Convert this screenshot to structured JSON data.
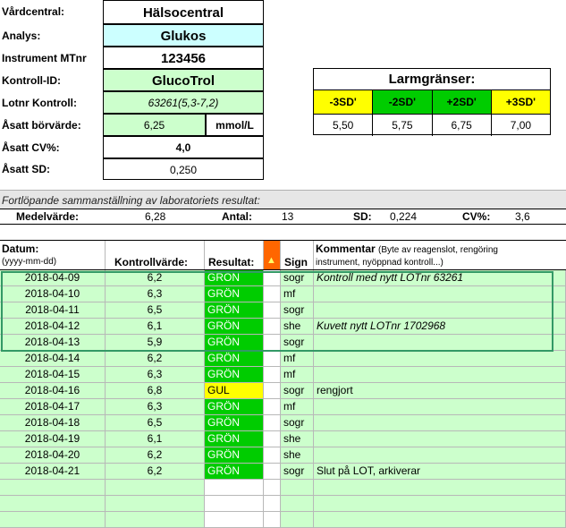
{
  "header": {
    "vardcentral_label": "Vårdcentral:",
    "vardcentral_value": "Hälsocentral",
    "analys_label": "Analys:",
    "analys_value": "Glukos",
    "instrument_label": "Instrument MTnr",
    "instrument_value": "123456",
    "kontroll_label": "Kontroll-ID:",
    "kontroll_value": "GlucoTrol",
    "lotnr_label": "Lotnr Kontroll:",
    "lotnr_value": "63261(5,3-7,2)",
    "borvarde_label": "Åsatt börvärde:",
    "borvarde_value": "6,25",
    "borvarde_unit": "mmol/L",
    "cv_label": "Åsatt CV%:",
    "cv_value": "4,0",
    "sd_label": "Åsatt SD:",
    "sd_value": "0,250"
  },
  "larm": {
    "title": "Larmgränser:",
    "headers": [
      "-3SD'",
      "-2SD'",
      "+2SD'",
      "+3SD'"
    ],
    "values": [
      "5,50",
      "5,75",
      "6,75",
      "7,00"
    ],
    "colors": [
      "#ffff00",
      "#00cc00",
      "#00cc00",
      "#ffff00"
    ]
  },
  "summary": {
    "caption": "Fortlöpande sammanställning av laboratoriets resultat:",
    "medel_label": "Medelvärde:",
    "medel_value": "6,28",
    "antal_label": "Antal:",
    "antal_value": "13",
    "sd_label": "SD:",
    "sd_value": "0,224",
    "cv_label": "CV%:",
    "cv_value": "3,6"
  },
  "table": {
    "col_datum": "Datum:",
    "col_datum_sub": "(yyyy-mm-dd)",
    "col_kontroll": "Kontrollvärde:",
    "col_resultat": "Resultat:",
    "col_sign": "Sign",
    "col_kommentar": "Kommentar",
    "col_kommentar_sub": "(Byte av reagenslot, rengöring",
    "col_kommentar_sub2": "instrument, nyöppnad kontroll...)",
    "rows": [
      {
        "date": "2018-04-09",
        "value": "6,2",
        "result": "GRÖN",
        "sign": "sogr",
        "comment": "Kontroll med nytt LOTnr 63261",
        "italic": true
      },
      {
        "date": "2018-04-10",
        "value": "6,3",
        "result": "GRÖN",
        "sign": "mf",
        "comment": "",
        "italic": false
      },
      {
        "date": "2018-04-11",
        "value": "6,5",
        "result": "GRÖN",
        "sign": "sogr",
        "comment": "",
        "italic": false
      },
      {
        "date": "2018-04-12",
        "value": "6,1",
        "result": "GRÖN",
        "sign": "she",
        "comment": "Kuvett nytt LOTnr 1702968",
        "italic": true
      },
      {
        "date": "2018-04-13",
        "value": "5,9",
        "result": "GRÖN",
        "sign": "sogr",
        "comment": "",
        "italic": false
      },
      {
        "date": "2018-04-14",
        "value": "6,2",
        "result": "GRÖN",
        "sign": "mf",
        "comment": "",
        "italic": false
      },
      {
        "date": "2018-04-15",
        "value": "6,3",
        "result": "GRÖN",
        "sign": "mf",
        "comment": "",
        "italic": false
      },
      {
        "date": "2018-04-16",
        "value": "6,8",
        "result": "GUL",
        "sign": "sogr",
        "comment": "rengjort",
        "italic": false
      },
      {
        "date": "2018-04-17",
        "value": "6,3",
        "result": "GRÖN",
        "sign": "mf",
        "comment": "",
        "italic": false
      },
      {
        "date": "2018-04-18",
        "value": "6,5",
        "result": "GRÖN",
        "sign": "sogr",
        "comment": "",
        "italic": false
      },
      {
        "date": "2018-04-19",
        "value": "6,1",
        "result": "GRÖN",
        "sign": "she",
        "comment": "",
        "italic": false
      },
      {
        "date": "2018-04-20",
        "value": "6,2",
        "result": "GRÖN",
        "sign": "she",
        "comment": "",
        "italic": false
      },
      {
        "date": "2018-04-21",
        "value": "6,2",
        "result": "GRÖN",
        "sign": "sogr",
        "comment": "Slut på LOT, arkiverar",
        "italic": false
      },
      {
        "date": "",
        "value": "",
        "result": "",
        "sign": "",
        "comment": "",
        "italic": false
      },
      {
        "date": "",
        "value": "",
        "result": "",
        "sign": "",
        "comment": "",
        "italic": false
      },
      {
        "date": "",
        "value": "",
        "result": "",
        "sign": "",
        "comment": "",
        "italic": false
      }
    ]
  },
  "colors": {
    "green_fill": "#00cc00",
    "light_green": "#ccffcc",
    "yellow": "#ffff00",
    "cyan": "#ccffff",
    "orange": "#ff6600",
    "frame_green": "#339966"
  }
}
